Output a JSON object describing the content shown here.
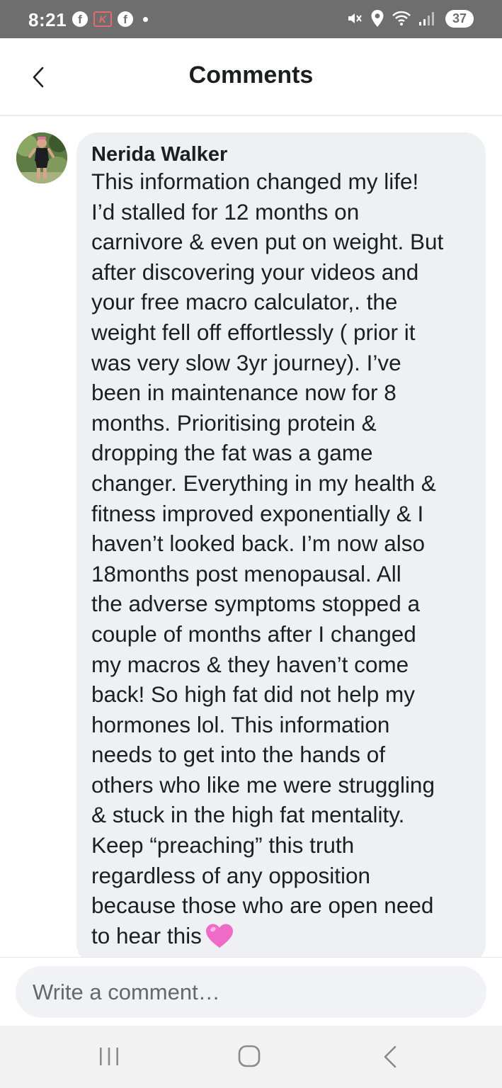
{
  "status_bar": {
    "time": "8:21",
    "battery": "37",
    "icons": [
      "facebook-icon",
      "k-app-icon",
      "facebook-icon",
      "notification-dot",
      "mute-icon",
      "location-icon",
      "wifi-icon",
      "signal-icon"
    ]
  },
  "header": {
    "title": "Comments",
    "back_icon": "chevron-left-icon"
  },
  "comment": {
    "author": "Nerida Walker",
    "text": "This information changed my life!\nI’d stalled for 12 months on\ncarnivore & even put on weight. But\nafter discovering your videos and\nyour free macro calculator,. the\nweight fell off effortlessly ( prior it\nwas very slow 3yr journey). I’ve\nbeen in maintenance now for 8\nmonths. Prioritising protein &\ndropping the fat was a game\nchanger. Everything in my health &\nfitness improved exponentially & I\nhaven’t looked back.  I’m now also\n18months post menopausal. All\nthe adverse symptoms stopped a\ncouple of months after I changed\nmy macros & they haven’t come\nback! So high fat did not help my\nhormones lol. This information\nneeds to get into the hands of\nothers who like me were struggling\n& stuck in the high fat mentality.\nKeep “preaching” this truth\nregardless of any opposition\nbecause those who are open need\nto hear this",
    "emoji": "pink-heart-icon"
  },
  "composer": {
    "placeholder": "Write a comment…"
  },
  "nav_bar": {
    "icons": [
      "recents-icon",
      "home-icon",
      "back-icon"
    ]
  },
  "colors": {
    "status_bar_bg": "#6e6e6e",
    "bubble_bg": "#eef0f3",
    "heart": "#f06bc8"
  }
}
